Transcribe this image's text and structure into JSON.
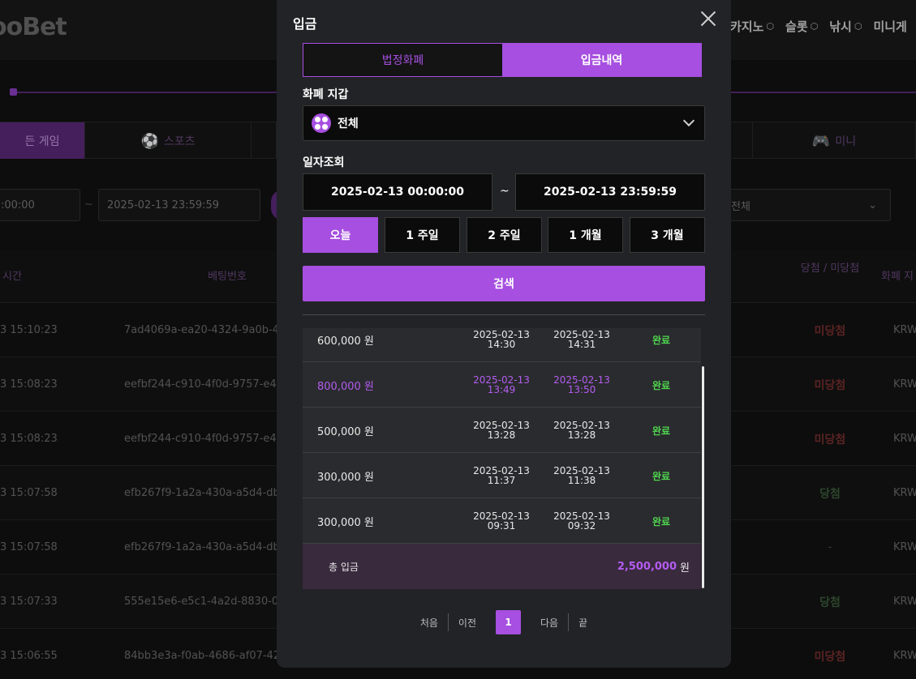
{
  "background": {
    "logo": "ooBet",
    "topnav": [
      {
        "label": "카지노",
        "id": "casino"
      },
      {
        "label": "슬롯",
        "id": "slot"
      },
      {
        "label": "낚시",
        "id": "fishing"
      },
      {
        "label": "미니게",
        "id": "mini"
      }
    ],
    "game_tabs": [
      "든 게임",
      "스포츠",
      "미니"
    ],
    "filters": {
      "date_from": ":00:00",
      "date_sep": "~",
      "date_to": "2025-02-13 23:59:59",
      "select": "전체"
    },
    "table_headers": {
      "time": "시간",
      "bet_number": "베팅번호",
      "result": "당첨 / 미당첨",
      "currency": "화폐 지"
    },
    "rows": [
      {
        "time": "3 15:10:23",
        "bet": "7ad4069a-ea20-4324-9a0b-4c7",
        "result": "미당첨",
        "cls": "res-lose",
        "cur": "KRW"
      },
      {
        "time": "3 15:08:23",
        "bet": "eefbf244-c910-4f0d-9757-e47",
        "result": "미당첨",
        "cls": "res-lose",
        "cur": "KRW"
      },
      {
        "time": "3 15:08:23",
        "bet": "eefbf244-c910-4f0d-9757-e47",
        "result": "미당첨",
        "cls": "res-lose",
        "cur": "KRW"
      },
      {
        "time": "3 15:07:58",
        "bet": "efb267f9-1a2a-430a-a5d4-db9",
        "result": "당첨",
        "cls": "res-win",
        "cur": "KRW"
      },
      {
        "time": "3 15:07:58",
        "bet": "efb267f9-1a2a-430a-a5d4-db9",
        "result": "-",
        "cls": "res-none",
        "cur": "KRW"
      },
      {
        "time": "3 15:07:33",
        "bet": "555e15e6-e5c1-4a2d-8830-091",
        "result": "당첨",
        "cls": "res-win",
        "cur": "KRW"
      },
      {
        "time": "3 15:06:55",
        "bet": "84bb3e3a-f0ab-4686-af07-428",
        "result": "미당첨",
        "cls": "res-lose",
        "cur": "KRW"
      }
    ]
  },
  "modal": {
    "title": "입금",
    "tabs": [
      {
        "label": "법정화폐",
        "active": false
      },
      {
        "label": "입금내역",
        "active": true
      }
    ],
    "wallet_label": "화폐 지갑",
    "wallet_value": "전체",
    "date_label": "일자조회",
    "date_from": "2025-02-13 00:00:00",
    "date_sep": "~",
    "date_to": "2025-02-13 23:59:59",
    "ranges": [
      {
        "label": "오늘",
        "active": true
      },
      {
        "label": "1 주일",
        "active": false
      },
      {
        "label": "2 주일",
        "active": false
      },
      {
        "label": "1 개월",
        "active": false
      },
      {
        "label": "3 개월",
        "active": false
      }
    ],
    "search_label": "검색",
    "deposits": [
      {
        "amount": "600,000 원",
        "req_date": "2025-02-13",
        "req_time": "14:30",
        "done_date": "2025-02-13",
        "done_time": "14:31",
        "status": "완료",
        "highlight": false
      },
      {
        "amount": "800,000 원",
        "req_date": "2025-02-13",
        "req_time": "13:49",
        "done_date": "2025-02-13",
        "done_time": "13:50",
        "status": "완료",
        "highlight": true
      },
      {
        "amount": "500,000 원",
        "req_date": "2025-02-13",
        "req_time": "13:28",
        "done_date": "2025-02-13",
        "done_time": "13:28",
        "status": "완료",
        "highlight": false
      },
      {
        "amount": "300,000 원",
        "req_date": "2025-02-13",
        "req_time": "11:37",
        "done_date": "2025-02-13",
        "done_time": "11:38",
        "status": "완료",
        "highlight": false
      },
      {
        "amount": "300,000 원",
        "req_date": "2025-02-13",
        "req_time": "09:31",
        "done_date": "2025-02-13",
        "done_time": "09:32",
        "status": "완료",
        "highlight": false
      }
    ],
    "total_label": "총 입금",
    "total_value": "2,500,000",
    "total_unit": "원",
    "pager": {
      "first": "처음",
      "prev": "이전",
      "current": "1",
      "next": "다음",
      "last": "끝"
    }
  },
  "colors": {
    "accent": "#a64fe0",
    "status_done": "#4fd64f"
  }
}
